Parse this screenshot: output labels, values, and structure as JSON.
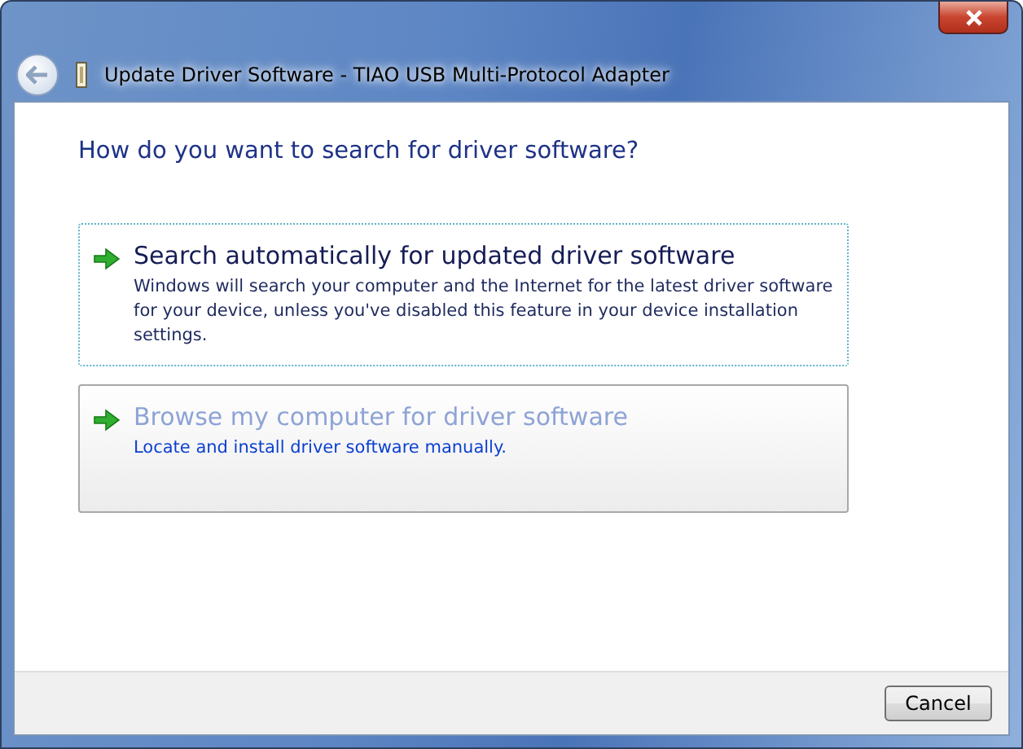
{
  "window": {
    "title": "Update Driver Software - TIAO USB Multi-Protocol Adapter"
  },
  "heading": "How do you want to search for driver software?",
  "options": [
    {
      "title": "Search automatically for updated driver software",
      "description": "Windows will search your computer and the Internet for the latest driver software for your device, unless you've disabled this feature in your device installation settings.",
      "focused": true,
      "hovered": false
    },
    {
      "title": "Browse my computer for driver software",
      "description": "Locate and install driver software manually.",
      "focused": false,
      "hovered": true
    }
  ],
  "buttons": [
    "Cancel"
  ]
}
